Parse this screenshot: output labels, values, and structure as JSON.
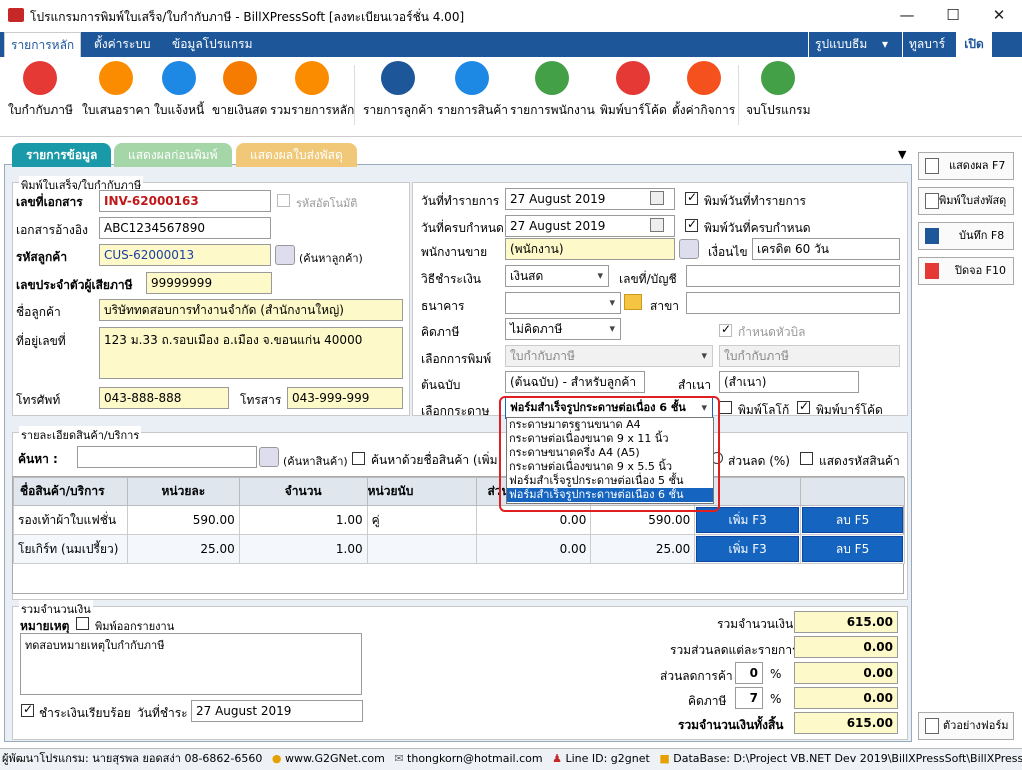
{
  "window": {
    "title": "โปรแกรมการพิมพ์ใบเสร็จ/ใบกำกับภาษี - BillXPressSoft [ลงทะเบียนเวอร์ชั่น 4.00]",
    "minimize": "—",
    "maximize": "☐",
    "close": "✕"
  },
  "menubar": {
    "items": [
      "รายการหลัก",
      "ตั้งค่าระบบ",
      "ข้อมูลโปรแกรม"
    ],
    "right": {
      "theme": "รูปแบบธีม",
      "theme_arrow": "▾",
      "toolbar": "ทูลบาร์",
      "open": "เปิด"
    }
  },
  "ribbon": [
    {
      "label": "ใบกำกับภาษี",
      "icon": "tax-invoice-icon",
      "color": "#e53935"
    },
    {
      "label": "ใบเสนอราคา",
      "icon": "quotation-icon",
      "color": "#fb8c00"
    },
    {
      "label": "ใบแจ้งหนี้",
      "icon": "invoice-icon",
      "color": "#1e88e5"
    },
    {
      "label": "ขายเงินสด",
      "icon": "cash-sale-icon",
      "color": "#f57c00"
    },
    {
      "label": "รวมรายการหลัก",
      "icon": "merge-items-icon",
      "color": "#fb8c00"
    },
    {
      "label": "รายการลูกค้า",
      "icon": "customer-list-icon",
      "color": "#1e5799"
    },
    {
      "label": "รายการสินค้า",
      "icon": "product-list-icon",
      "color": "#1e88e5"
    },
    {
      "label": "รายการพนักงาน",
      "icon": "employee-list-icon",
      "color": "#43a047"
    },
    {
      "label": "พิมพ์บาร์โค้ด",
      "icon": "barcode-icon",
      "color": "#e53935"
    },
    {
      "label": "ตั้งค่ากิจการ",
      "icon": "company-settings-icon",
      "color": "#f4511e"
    },
    {
      "label": "จบโปรแกรม",
      "icon": "power-icon",
      "color": "#43a047"
    }
  ],
  "tabs": [
    "รายการข้อมูล",
    "แสดงผลก่อนพิมพ์",
    "แสดงผลใบส่งพัสดุ"
  ],
  "header_group": {
    "title": "พิมพ์ใบเสร็จ/ใบกำกับภาษี",
    "doc_no_label": "เลขที่เอกสาร",
    "doc_no": "INV-62000163",
    "auto_no_label": "รหัสอัตโนมัติ",
    "ref_label": "เอกสารอ้างอิง",
    "ref": "ABC1234567890",
    "cust_code_label": "รหัสลูกค้า",
    "cust_code": "CUS-62000013",
    "find_cust": "(ค้นหาลูกค้า)",
    "taxid_label": "เลขประจำตัวผู้เสียภาษี",
    "taxid": "99999999",
    "cust_name_label": "ชื่อลูกค้า",
    "cust_name": "บริษัททดสอบการทำงานจำกัด (สำนักงานใหญ่)",
    "addr_label": "ที่อยู่เลขที่",
    "addr": "123 ม.33 ถ.รอบเมือง อ.เมือง จ.ขอนแก่น 40000",
    "phone_label": "โทรศัพท์",
    "phone": "043-888-888",
    "fax_label": "โทรสาร",
    "fax": "043-999-999"
  },
  "right_form": {
    "date_label": "วันที่ทำรายการ",
    "date": "27   August   2019",
    "print_date": "พิมพ์วันที่ทำรายการ",
    "due_label": "วันที่ครบกำหนด",
    "due": "27   August   2019",
    "print_due": "พิมพ์วันที่ครบกำหนด",
    "sales_label": "พนักงานขาย",
    "sales": "(พนักงาน)",
    "cond_label": "เงื่อนไข",
    "cond": "เครดิต 60 วัน",
    "pay_label": "วิธีชำระเงิน",
    "pay": "เงินสด",
    "acct_label": "เลขที่/บัญชี",
    "bank_label": "ธนาคาร",
    "branch_label": "สาขา",
    "vat_label": "คิดภาษี",
    "vat": "ไม่คิดภาษี",
    "bill_head": "กำหนดหัวบิล",
    "print_type_label": "เลือกการพิมพ์",
    "print_type": "ใบกำกับภาษี",
    "print_type2": "ใบกำกับภาษี",
    "orig_label": "ต้นฉบับ",
    "orig": "(ต้นฉบับ) - สำหรับลูกค้า",
    "copy_label": "สำเนา",
    "copy": "(สำเนา)",
    "paper_label": "เลือกกระดาษ",
    "paper": "ฟอร์มสำเร็จรูปกระดาษต่อเนื่อง 6 ชั้น",
    "print_logo": "พิมพ์โลโก้",
    "print_barcode": "พิมพ์บาร์โค้ด"
  },
  "paper_options": [
    "กระดาษมาตรฐานขนาด A4",
    "กระดาษต่อเนื่องขนาด 9 x 11 นิ้ว",
    "กระดาษขนาดครึ่ง A4 (A5)",
    "กระดาษต่อเนื่องขนาด 9 x 5.5 นิ้ว",
    "ฟอร์มสำเร็จรูปกระดาษต่อเนื่อง 5 ชั้น",
    "ฟอร์มสำเร็จรูปกระดาษต่อเนื่อง 6 ชั้น"
  ],
  "items_group": {
    "title": "รายละเอียดสินค้า/บริการ",
    "search_label": "ค้นหา :",
    "find_item": "(ค้นหาสินค้า)",
    "search_by_name": "ค้นหาด้วยชื่อสินค้า (เพิ่ม",
    "discount_pct": "ส่วนลด (%)",
    "show_code": "แสดงรหัสสินค้า",
    "columns": [
      "ชื่อสินค้า/บริการ",
      "หน่วยละ",
      "จำนวน",
      "หน่วยนับ",
      "ส่วนล",
      "",
      ""
    ],
    "rows": [
      {
        "name": "รองเท้าผ้าใบแฟชั่น",
        "price": "590.00",
        "qty": "1.00",
        "unit": "คู่",
        "disc": "0.00",
        "total": "590.00",
        "add": "เพิ่ม F3",
        "del": "ลบ F5"
      },
      {
        "name": "โยเกิร์ท (นมเปรี้ยว)",
        "price": "25.00",
        "qty": "1.00",
        "unit": "",
        "disc": "0.00",
        "total": "25.00",
        "add": "เพิ่ม F3",
        "del": "ลบ F5"
      }
    ]
  },
  "summary": {
    "title": "รวมจำนวนเงิน",
    "note_label": "หมายเหตุ",
    "print_note": "พิมพ์ออกรายงาน",
    "note": "ทดสอบหมายเหตุใบกำกับภาษี",
    "paid": "ชำระเงินเรียบร้อย",
    "pay_date_label": "วันที่ชำระ",
    "pay_date": "27   August   2019",
    "total_label": "รวมจำนวนเงิน",
    "total": "615.00",
    "item_disc_label": "รวมส่วนลดแต่ละรายการ",
    "item_disc": "0.00",
    "bill_disc_label": "ส่วนลดการค้า",
    "bill_disc_pct": "0",
    "bill_disc": "0.00",
    "vat_label": "คิดภาษี",
    "vat_pct": "7",
    "vat": "0.00",
    "pct": "%",
    "grand_label": "รวมจำนวนเงินทั้งสิ้น",
    "grand": "615.00"
  },
  "side_buttons": {
    "show": "แสดงผล F7",
    "parcel": "พิมพ์ใบส่งพัสดุ",
    "save": "บันทึก F8",
    "close": "ปิดจอ F10",
    "sample": "ตัวอย่างฟอร์ม"
  },
  "status": {
    "dev": "ผู้พัฒนาโปรแกรม: นายสุรพล ยอดสง่า 08-6862-6560",
    "web": "www.G2GNet.com",
    "email": "thongkorn@hotmail.com",
    "line": "Line ID: g2gnet",
    "db": "DataBase: D:\\Project VB.NET Dev 2019\\BillXPressSoft\\BillXPressSoft\\BillXPress..."
  }
}
